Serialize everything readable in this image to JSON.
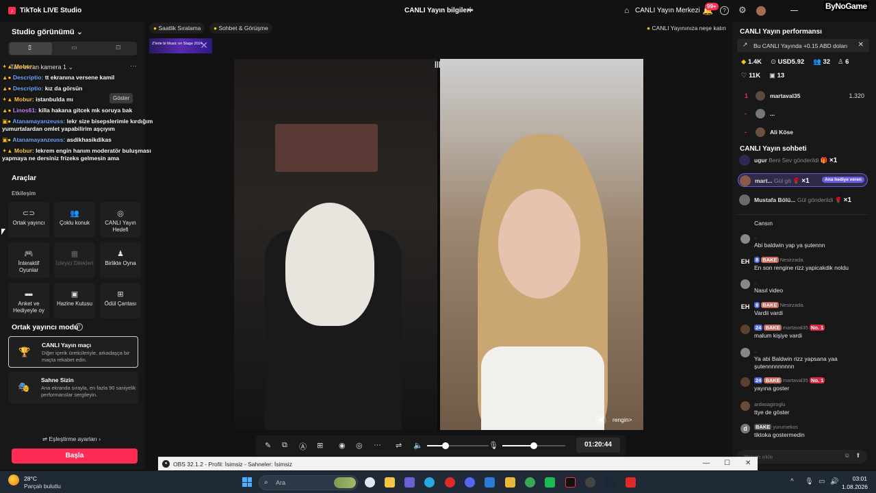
{
  "window": {
    "app_name": "TikTok LIVE Studio",
    "center_title": "CANLI Yayın bilgileri",
    "live_center": "CANLI Yayın Merkezi",
    "notif_count": "99+",
    "brand": "ByNoGame"
  },
  "left": {
    "studio_view": "Studio görünümü",
    "source": "Tam ekran kamera 1",
    "show_button": "Göster",
    "overlay_chat": [
      {
        "nick": "Mobur:",
        "text": ""
      },
      {
        "nick": "Descriptio:",
        "text": "tt ekranına versene kamil"
      },
      {
        "nick": "Descriptio:",
        "text": "kız da görsün"
      },
      {
        "nick": "Mobur:",
        "text": "istanbulda mı"
      },
      {
        "nick": "Linos61:",
        "text": "killa hakana gitcek mk soruya bak"
      },
      {
        "nick": "Atanamayanzeuss:",
        "text": "lekr size bisepslerimle kırdığım yumurtalardan omlet yapabilirim aşçıyım"
      },
      {
        "nick": "Atanamayanzeuss:",
        "text": "asdikhasikdikas"
      },
      {
        "nick": "Mobur:",
        "text": "lekrem engin hanım moderatör buluşması yapmaya ne dersiniz frizeks gelmesin ama"
      }
    ],
    "tools_title": "Araçlar",
    "tools_sub": "Etkileşim",
    "tools": [
      {
        "label": "Ortak yayıncı",
        "icon": "link-icon",
        "disabled": false
      },
      {
        "label": "Çoklu konuk",
        "icon": "users-icon",
        "disabled": false
      },
      {
        "label": "CANLI Yayın Hedefi",
        "icon": "target-icon",
        "disabled": false
      },
      {
        "label": "İnteraktif Oyunlar",
        "icon": "gamepad-icon",
        "disabled": false
      },
      {
        "label": "İzleyici Dilekleri",
        "icon": "gift-box-icon",
        "disabled": true
      },
      {
        "label": "Birlikte Oyna",
        "icon": "play-together-icon",
        "disabled": false
      },
      {
        "label": "Anket ve Hediyeyle oy",
        "icon": "poll-icon",
        "disabled": false
      },
      {
        "label": "Hazine Kutusu",
        "icon": "treasure-icon",
        "disabled": false
      },
      {
        "label": "Ödül Çantası",
        "icon": "bag-icon",
        "disabled": false
      }
    ],
    "cohost_title": "Ortak yayıncı modu",
    "modes": [
      {
        "title": "CANLI Yayın maçı",
        "desc": "Diğer içerik üreticileriyle, arkadaşça bir maçta rekabet edin."
      },
      {
        "title": "Sahne Sizin",
        "desc": "Ana ekranda sırayla, en fazla 90 saniyelik performanslar sergileyin."
      }
    ],
    "settings": "Eşleştirme ayarları",
    "start": "Başla"
  },
  "center": {
    "pill1": "Saatlik Sıralama",
    "pill2": "Sohbet & Görüşme",
    "tip": "CANLI Yayınınıza neşe katın",
    "banner_text": "Z'lerle bi Music on Stage 2024",
    "guest_name": "rengin>",
    "timer": "01:20:44",
    "mic_level": 0.5,
    "volume_level": 0.3
  },
  "right": {
    "perf_title": "CANLI Yayın performansı",
    "perf_msg": "Bu CANLI Yayında +0.15 ABD doları",
    "stats": {
      "diamonds": "1.4K",
      "usd": "USD5.92",
      "viewers": "32",
      "followers": "6",
      "likes": "11K",
      "gifts": "13"
    },
    "ranking": [
      {
        "rank": "1",
        "name": "martaval35",
        "score": "1.320"
      },
      {
        "rank": "-",
        "name": "...",
        "score": ""
      },
      {
        "rank": "-",
        "name": "Ali Köse",
        "score": ""
      }
    ],
    "chat_title": "CANLI Yayın sohbeti",
    "gifts": [
      {
        "name": "ugur",
        "text": "Beni Sev gönderildi",
        "count": "×1",
        "highlight": false,
        "badge": ""
      },
      {
        "name": "mart...",
        "text": "Gül gö",
        "count": "×1",
        "highlight": true,
        "badge": "Ana hediye veren"
      },
      {
        "name": "Mustafa Bölü...",
        "text": "Gül gönderildi",
        "count": "×1",
        "highlight": false,
        "badge": ""
      }
    ],
    "messages": [
      {
        "meta": "",
        "text": "Cansın",
        "avatar": "",
        "lvl": "",
        "fan": "",
        "no1": ""
      },
      {
        "meta": "..",
        "text": "Abi baldwin yap ya şutennn",
        "avatar": "",
        "lvl": "",
        "fan": "",
        "no1": ""
      },
      {
        "meta": "Nesirzada.",
        "text": "En son rengine rizz yapicakdik noldu",
        "avatar": "EH",
        "lvl": "8",
        "fan": "BAKE",
        "no1": ""
      },
      {
        "meta": "..",
        "text": "Nasıl video",
        "avatar": "",
        "lvl": "",
        "fan": "",
        "no1": ""
      },
      {
        "meta": "Nesirzada.",
        "text": "Vardii vardi",
        "avatar": "EH",
        "lvl": "8",
        "fan": "BAKE",
        "no1": ""
      },
      {
        "meta": "martaval35",
        "text": "malum kişiye vardi",
        "avatar": "",
        "lvl": "24",
        "fan": "BAKE",
        "no1": "No. 1"
      },
      {
        "meta": "..",
        "text": "Ya abi Baldwin rizz yapsana yaa şutennnnnnnnn",
        "avatar": "",
        "lvl": "",
        "fan": "",
        "no1": ""
      },
      {
        "meta": "martaval35",
        "text": "yayına goster",
        "avatar": "",
        "lvl": "24",
        "fan": "BAKE",
        "no1": "No. 1"
      },
      {
        "meta": "ardasagiroglu",
        "text": "ttye de göster",
        "avatar": "",
        "lvl": "",
        "fan": "",
        "no1": ""
      },
      {
        "meta": "yurumekos",
        "text": "tiktoka gostermedin",
        "avatar": "d",
        "lvl": "",
        "fan": "BAKE",
        "no1": ""
      }
    ],
    "chat_placeholder": "Yorum ekle"
  },
  "obs": {
    "title": "OBS 32.1.2 - Profil: İsimsiz - Sahneler: İsimsiz"
  },
  "taskbar": {
    "temp": "28°C",
    "weather": "Parçalı bulutlu",
    "search": "Ara",
    "time": "03:01",
    "date": "1.08.2026"
  }
}
